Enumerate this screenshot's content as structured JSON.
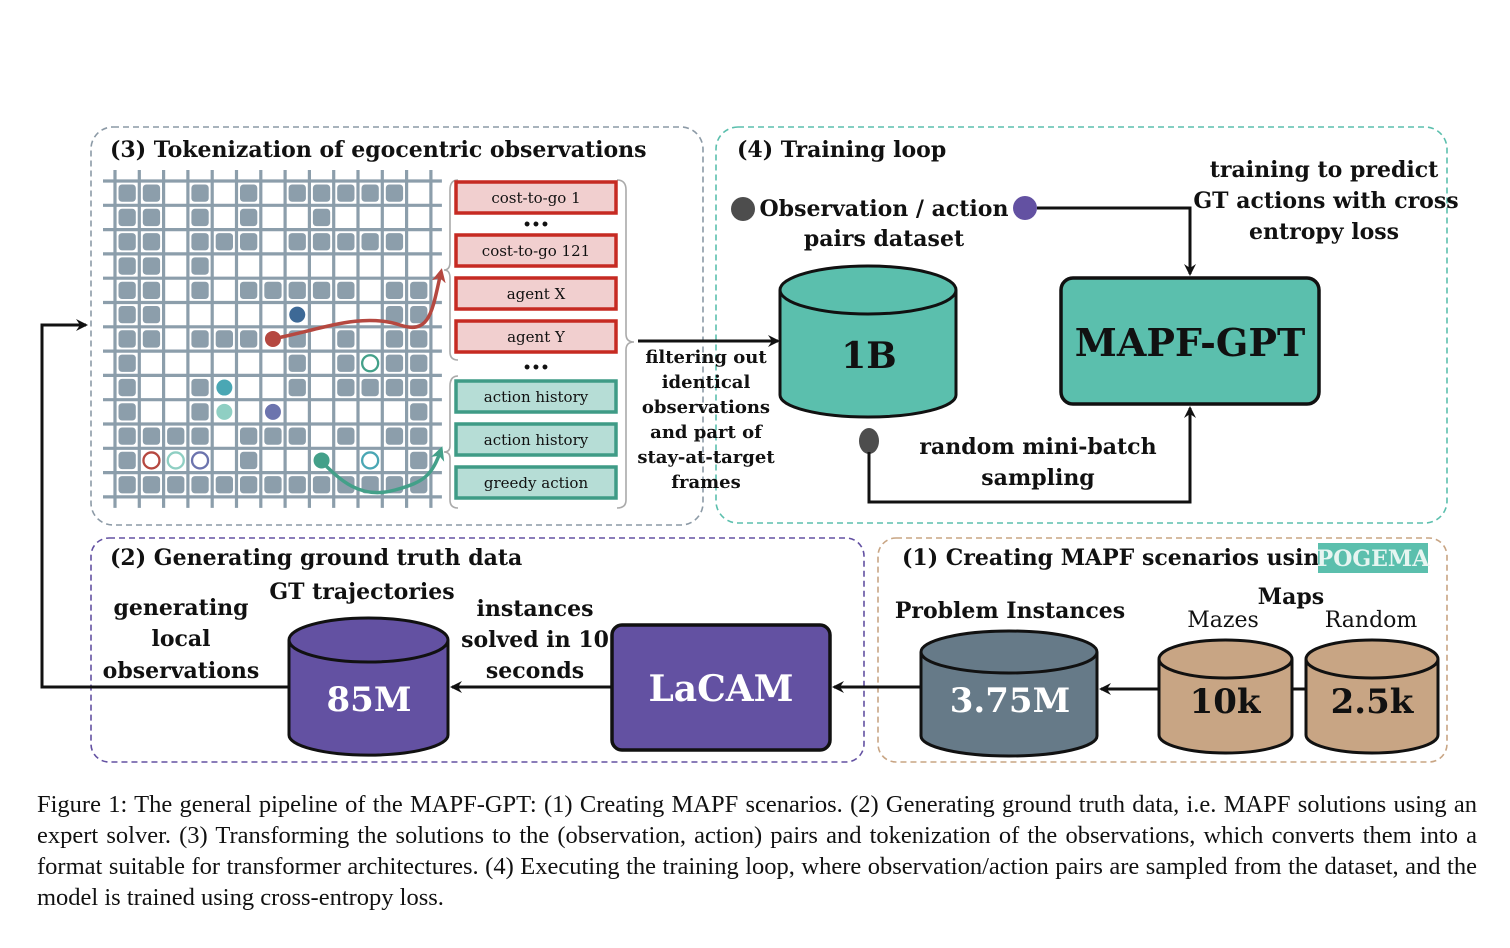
{
  "colors": {
    "teal": "#5bbfad",
    "purple": "#6351a2",
    "slate": "#667a88",
    "tan": "#c8a584",
    "grid": "#8c9eab",
    "red_token_border": "#c62a22",
    "red_token_fill": "#f1cfcf",
    "green_token_border": "#3f9b86",
    "green_token_fill": "#b6ddd6",
    "section3_border": "#8c9aa6",
    "section4_border": "#5bbfad",
    "section2_border": "#6351a2",
    "section1_border": "#c8a584",
    "agent_red": "#b54840",
    "agent_blue": "#3d6996",
    "agent_teal": "#4aa7b4",
    "agent_lightteal": "#8fcfc3",
    "agent_purple": "#6c74ae",
    "agent_green": "#43a089",
    "dot_gray": "#4d4d4d"
  },
  "section3": {
    "title": "(3) Tokenization of egocentric observations",
    "grid": {
      "rows": 13,
      "cols": 13,
      "obstacles": [
        [
          0,
          1,
          3,
          5,
          7,
          8,
          9,
          10,
          11
        ],
        [
          0,
          1,
          3,
          5,
          8
        ],
        [
          0,
          1,
          3,
          4,
          5,
          7,
          8,
          9,
          10,
          11
        ],
        [
          0,
          1,
          3
        ],
        [
          0,
          1,
          3,
          5,
          6,
          7,
          8,
          9,
          11,
          12
        ],
        [
          0,
          1,
          11,
          12
        ],
        [
          0,
          1,
          3,
          4,
          5,
          7,
          9,
          11,
          12
        ],
        [
          0,
          7,
          9,
          11,
          12
        ],
        [
          0,
          3,
          7,
          9,
          10,
          11,
          12
        ],
        [
          0,
          3,
          12
        ],
        [
          0,
          1,
          2,
          3,
          5,
          6,
          7,
          9,
          11,
          12
        ],
        [
          0,
          5,
          12
        ],
        [
          0,
          1,
          2,
          3,
          4,
          5,
          6,
          7,
          8,
          9,
          10,
          11,
          12
        ]
      ],
      "agents": [
        {
          "name": "agent-red",
          "row": 6,
          "col": 6,
          "color": "agent_red",
          "type": "filled"
        },
        {
          "name": "agent-blue",
          "row": 5,
          "col": 7,
          "color": "agent_blue",
          "type": "filled"
        },
        {
          "name": "agent-teal",
          "row": 8,
          "col": 4,
          "color": "agent_teal",
          "type": "filled"
        },
        {
          "name": "agent-lightteal",
          "row": 9,
          "col": 4,
          "color": "agent_lightteal",
          "type": "filled"
        },
        {
          "name": "agent-purple",
          "row": 9,
          "col": 6,
          "color": "agent_purple",
          "type": "filled"
        },
        {
          "name": "agent-green",
          "row": 11,
          "col": 8,
          "color": "agent_green",
          "type": "filled"
        },
        {
          "name": "goal-red",
          "row": 11,
          "col": 1,
          "color": "agent_red",
          "type": "ring"
        },
        {
          "name": "goal-lightteal",
          "row": 11,
          "col": 2,
          "color": "agent_lightteal",
          "type": "ring"
        },
        {
          "name": "goal-purple",
          "row": 11,
          "col": 3,
          "color": "agent_purple",
          "type": "ring"
        },
        {
          "name": "goal-green",
          "row": 7,
          "col": 10,
          "color": "agent_green",
          "type": "ring"
        },
        {
          "name": "goal-teal",
          "row": 11,
          "col": 10,
          "color": "agent_teal",
          "type": "ring"
        }
      ]
    },
    "tokens": [
      {
        "label": "cost-to-go 1",
        "kind": "red"
      },
      {
        "label": "cost-to-go 121",
        "kind": "red"
      },
      {
        "label": "agent X",
        "kind": "red"
      },
      {
        "label": "agent Y",
        "kind": "red"
      },
      {
        "label": "action history",
        "kind": "green"
      },
      {
        "label": "action history",
        "kind": "green"
      },
      {
        "label": "greedy action",
        "kind": "green"
      }
    ],
    "ellipsis": "•••"
  },
  "filter_text": [
    "filtering out",
    "identical",
    "observations",
    "and part of",
    "stay-at-target",
    "frames"
  ],
  "section4": {
    "title": "(4) Training loop",
    "dataset_label": [
      "Observation / action",
      "pairs dataset"
    ],
    "dataset_value": "1B",
    "model_label": "MAPF-GPT",
    "training_text": [
      "training to predict",
      "GT actions with cross",
      "entropy loss"
    ],
    "sampling_text": [
      "random mini-batch",
      "sampling"
    ]
  },
  "section2": {
    "title": "(2) Generating ground truth data",
    "gt_label": "GT trajectories",
    "gt_value": "85M",
    "solver_label": "LaCAM",
    "solved_text": [
      "instances",
      "solved in 10",
      "seconds"
    ],
    "local_obs_text": [
      "generating",
      "local",
      "observations"
    ]
  },
  "section1": {
    "title": "(1) Creating MAPF scenarios using",
    "badge": "POGEMA",
    "instances_label": "Problem Instances",
    "instances_value": "3.75M",
    "maps_label": "Maps",
    "mazes_label": "Mazes",
    "mazes_value": "10k",
    "random_label": "Random",
    "random_value": "2.5k"
  },
  "caption": "Figure 1: The general pipeline of the MAPF-GPT: (1) Creating MAPF scenarios. (2) Generating ground truth data, i.e. MAPF solutions using an expert solver. (3) Transforming the solutions to the (observation, action) pairs and tokenization of the observations, which converts them into a format suitable for transformer architectures. (4) Executing the training loop, where observation/action pairs are sampled from the dataset, and the model is trained using cross-entropy loss."
}
